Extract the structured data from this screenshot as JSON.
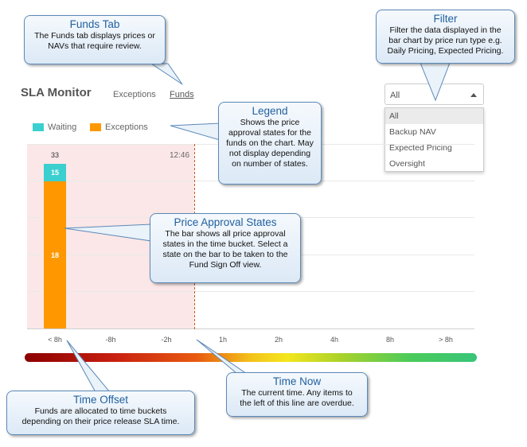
{
  "widget": {
    "title": "SLA Monitor",
    "tabs": [
      {
        "label": "Exceptions",
        "active": false
      },
      {
        "label": "Funds",
        "active": true
      }
    ]
  },
  "filter": {
    "selected": "All",
    "options": [
      "All",
      "Backup NAV",
      "Expected Pricing",
      "Oversight"
    ]
  },
  "legend": [
    {
      "label": "Waiting",
      "color": "#3ccfcf"
    },
    {
      "label": "Exceptions",
      "color": "#ff9800"
    }
  ],
  "time_now_label": "12:46",
  "chart_data": {
    "type": "bar",
    "categories": [
      "< 8h",
      "-8h",
      "-2h",
      "1h",
      "2h",
      "4h",
      "8h",
      "> 8h"
    ],
    "series": [
      {
        "name": "Waiting",
        "values": [
          15,
          0,
          0,
          0,
          0,
          0,
          0,
          0
        ]
      },
      {
        "name": "Exceptions",
        "values": [
          18,
          0,
          0,
          0,
          0,
          0,
          0,
          0
        ]
      }
    ],
    "totals": [
      33,
      0,
      0,
      0,
      0,
      0,
      0,
      0
    ],
    "stacked": true
  },
  "callouts": {
    "funds_tab": {
      "title": "Funds Tab",
      "body": [
        "The Funds tab displays prices or",
        "NAVs that require review."
      ]
    },
    "filter": {
      "title": "Filter",
      "body": [
        "Filter the data displayed in the",
        "bar chart by price run type e.g.",
        "Daily Pricing, Expected Pricing."
      ]
    },
    "legend": {
      "title": "Legend",
      "body": [
        "Shows the price",
        "approval states for the",
        "funds on the chart. May",
        "not display depending",
        "on number of states."
      ]
    },
    "price_states": {
      "title": "Price Approval States",
      "body": [
        "The bar shows all price approval",
        "states in the time bucket. Select a",
        "state on the bar to be taken to the",
        "Fund Sign Off view."
      ]
    },
    "time_now": {
      "title": "Time Now",
      "body": [
        "The current time. Any items to",
        "the left of this line are overdue."
      ]
    },
    "time_offset": {
      "title": "Time Offset",
      "body": [
        "Funds are allocated to time buckets",
        "depending on their price release SLA time."
      ]
    }
  }
}
